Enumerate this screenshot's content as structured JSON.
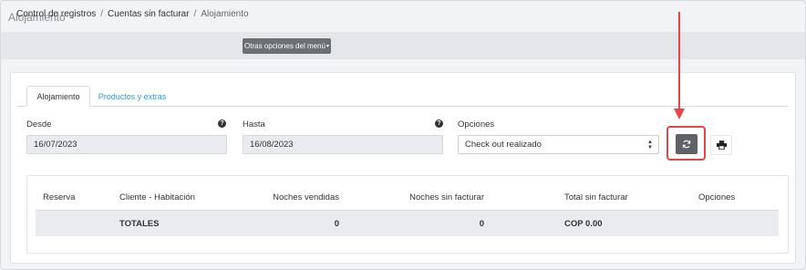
{
  "page": {
    "title": "Alojamiento"
  },
  "breadcrumb": {
    "items": [
      "Control de registros",
      "Cuentas sin facturar",
      "Alojamiento"
    ],
    "separator": "/"
  },
  "more_options": {
    "label": "Otras opciones del menú",
    "caret": "▾"
  },
  "tabs": [
    {
      "label": "Alojamiento",
      "active": true
    },
    {
      "label": "Productos y extras",
      "active": false
    }
  ],
  "filters": {
    "desde": {
      "label": "Desde",
      "value": "16/07/2023",
      "help": "?"
    },
    "hasta": {
      "label": "Hasta",
      "value": "16/08/2023",
      "help": "?"
    },
    "opciones": {
      "label": "Opciones",
      "selected": "Check out realizado"
    }
  },
  "icons": {
    "refresh": "refresh-icon",
    "print": "print-icon",
    "help": "question-circle-icon",
    "select_arrows": "sort-arrows-icon"
  },
  "table": {
    "columns": [
      "Reserva",
      "Cliente - Habitación",
      "Noches vendidas",
      "Noches sin facturar",
      "Total sin facturar",
      "Opciones"
    ],
    "totals": {
      "label": "TOTALES",
      "noches_vendidas": "0",
      "noches_sin_facturar": "0",
      "total_sin_facturar": "COP 0.00"
    }
  },
  "colors": {
    "accent_link": "#2a9fd6",
    "annotation_red": "#e4444a",
    "button_dark": "#5f6368"
  }
}
